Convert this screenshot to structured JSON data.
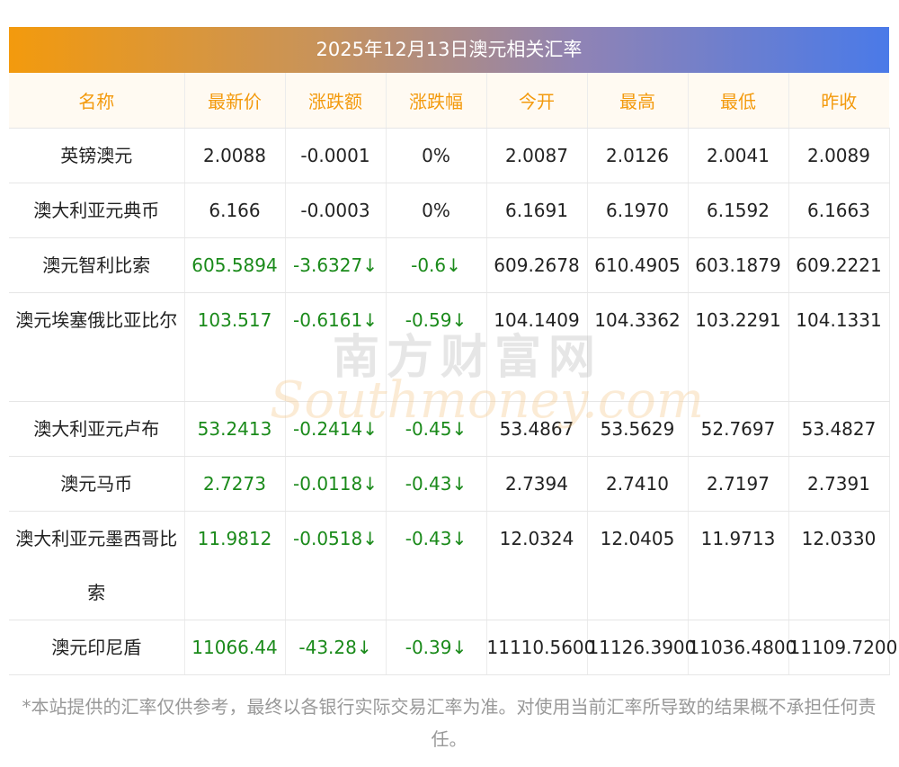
{
  "title": "2025年12月13日澳元相关汇率",
  "headers": [
    "名称",
    "最新价",
    "涨跌额",
    "涨跌幅",
    "今开",
    "最高",
    "最低",
    "昨收"
  ],
  "rows": [
    {
      "name": "英镑澳元",
      "latest": "2.0088",
      "change": "-0.0001",
      "pct": "0%",
      "open": "2.0087",
      "high": "2.0126",
      "low": "2.0041",
      "prev": "2.0089",
      "down": false
    },
    {
      "name": "澳大利亚元典币",
      "latest": "6.166",
      "change": "-0.0003",
      "pct": "0%",
      "open": "6.1691",
      "high": "6.1970",
      "low": "6.1592",
      "prev": "6.1663",
      "down": false
    },
    {
      "name": "澳元智利比索",
      "latest": "605.5894",
      "change": "-3.6327↓",
      "pct": "-0.6↓",
      "open": "609.2678",
      "high": "610.4905",
      "low": "603.1879",
      "prev": "609.2221",
      "down": true
    },
    {
      "name": "澳元埃塞俄比亚比尔",
      "latest": "103.517",
      "change": "-0.6161↓",
      "pct": "-0.59↓",
      "open": "104.1409",
      "high": "104.3362",
      "low": "103.2291",
      "prev": "104.1331",
      "down": true
    },
    {
      "name": "澳大利亚元卢布",
      "latest": "53.2413",
      "change": "-0.2414↓",
      "pct": "-0.45↓",
      "open": "53.4867",
      "high": "53.5629",
      "low": "52.7697",
      "prev": "53.4827",
      "down": true
    },
    {
      "name": "澳元马币",
      "latest": "2.7273",
      "change": "-0.0118↓",
      "pct": "-0.43↓",
      "open": "2.7394",
      "high": "2.7410",
      "low": "2.7197",
      "prev": "2.7391",
      "down": true
    },
    {
      "name": "澳大利亚元墨西哥比索",
      "latest": "11.9812",
      "change": "-0.0518↓",
      "pct": "-0.43↓",
      "open": "12.0324",
      "high": "12.0405",
      "low": "11.9713",
      "prev": "12.0330",
      "down": true
    },
    {
      "name": "澳元印尼盾",
      "latest": "11066.44",
      "change": "-43.28↓",
      "pct": "-0.39↓",
      "open": "11110.5600",
      "high": "11126.3900",
      "low": "11036.4800",
      "prev": "11109.7200",
      "down": true
    }
  ],
  "note": "*本站提供的汇率仅供参考，最终以各银行实际交易汇率为准。对使用当前汇率所导致的结果概不承担任何责任。",
  "watermark": {
    "cn": "南方财富网",
    "en": "Southmoney.com"
  },
  "colors": {
    "header_text": "#f39a0d",
    "down": "#1a8a1a",
    "title_start": "#f39a0d",
    "title_end": "#4a7ae8"
  }
}
